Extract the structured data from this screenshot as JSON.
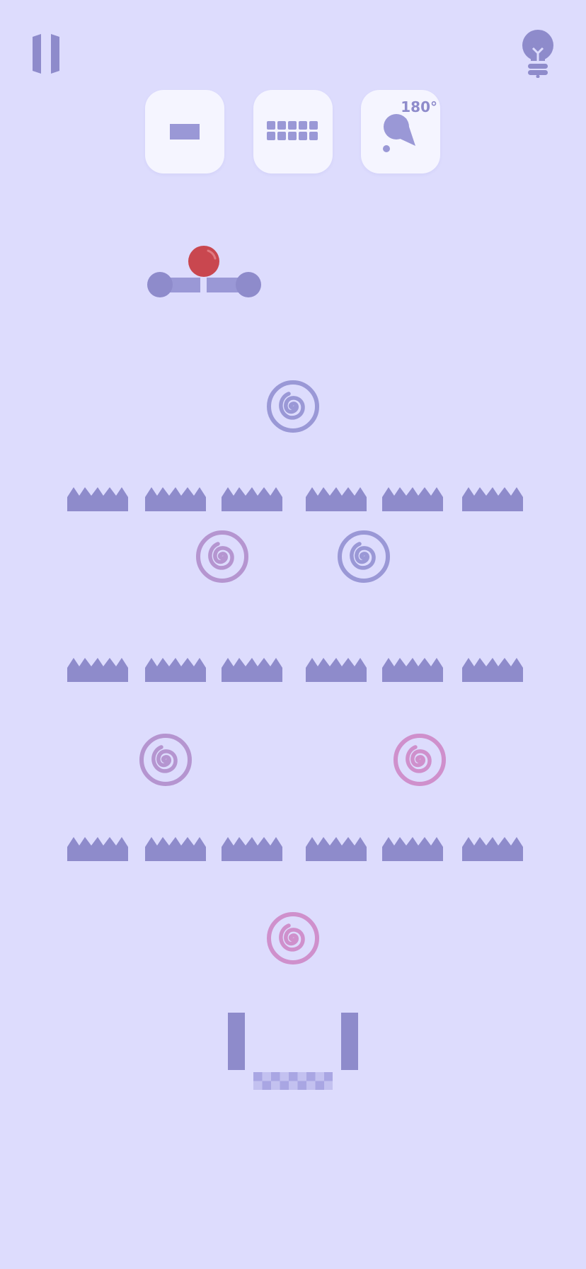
{
  "toolbar": {
    "tools": [
      {
        "name": "plank"
      },
      {
        "name": "brick-grid"
      },
      {
        "name": "cannon",
        "angle_label": "180°"
      }
    ]
  },
  "colors": {
    "background": "#dddcfd",
    "obstacle": "#8e8bcb",
    "ball": "#c9474f",
    "swirl_blue": "#9a98d6",
    "swirl_purple": "#b595d0",
    "swirl_pink": "#cf90cc"
  },
  "icons": {
    "pause": "pause-icon",
    "hint": "lightbulb-icon"
  }
}
